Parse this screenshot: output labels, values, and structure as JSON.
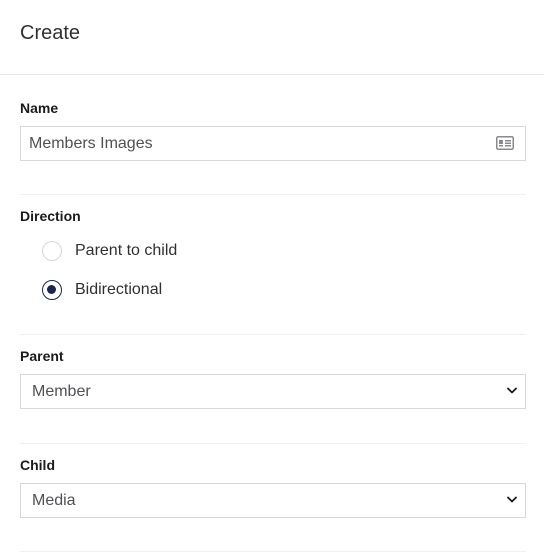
{
  "header": {
    "title": "Create"
  },
  "name_field": {
    "label": "Name",
    "value": "Members Images",
    "icon": "id-card-icon"
  },
  "direction": {
    "label": "Direction",
    "options": [
      {
        "label": "Parent to child",
        "selected": false
      },
      {
        "label": "Bidirectional",
        "selected": true
      }
    ]
  },
  "parent": {
    "label": "Parent",
    "selected": "Member"
  },
  "child": {
    "label": "Child",
    "selected": "Media"
  },
  "colors": {
    "accent": "#1b264f",
    "border": "#d8d7d9"
  }
}
